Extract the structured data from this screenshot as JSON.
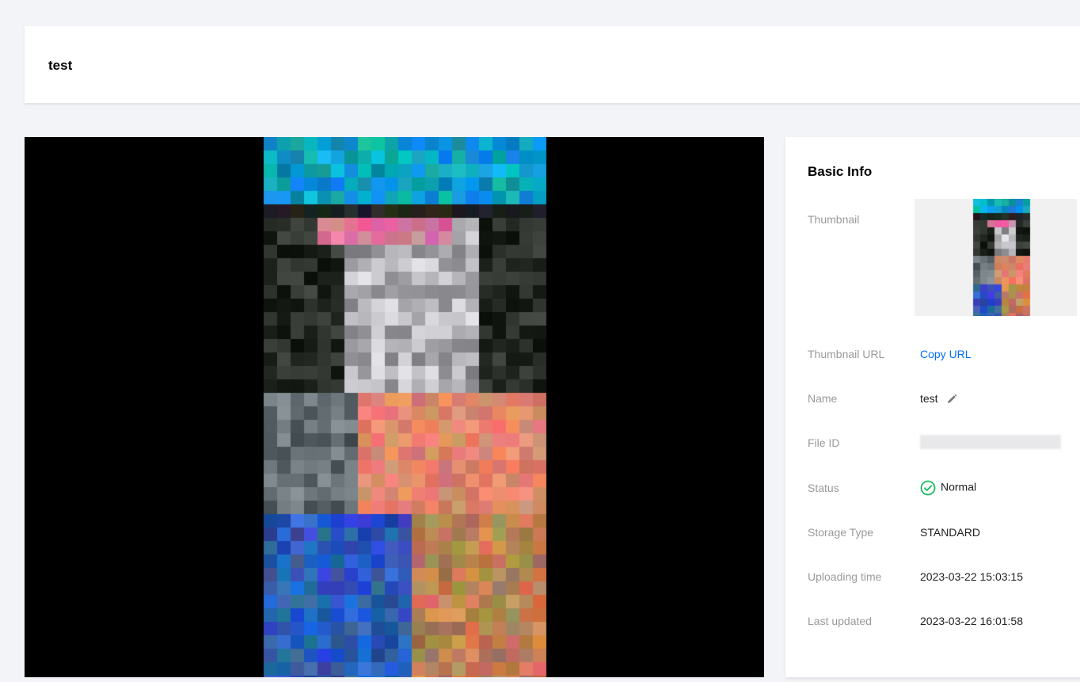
{
  "header": {
    "title": "test"
  },
  "basic_info": {
    "title": "Basic Info",
    "rows": {
      "thumbnail": {
        "label": "Thumbnail"
      },
      "thumbnail_url": {
        "label": "Thumbnail URL",
        "value": "Copy URL"
      },
      "name": {
        "label": "Name",
        "value": "test"
      },
      "file_id": {
        "label": "File ID"
      },
      "status": {
        "label": "Status",
        "value": "Normal"
      },
      "storage_type": {
        "label": "Storage Type",
        "value": "STANDARD"
      },
      "uploading_time": {
        "label": "Uploading time",
        "value": "2023-03-22 15:03:15"
      },
      "last_updated": {
        "label": "Last updated",
        "value": "2023-03-22 16:01:58"
      }
    }
  },
  "icons": {
    "status": "check-circle-icon",
    "edit": "pencil-icon"
  },
  "colors": {
    "link": "#006eff",
    "status_ok": "#1cb85c"
  }
}
